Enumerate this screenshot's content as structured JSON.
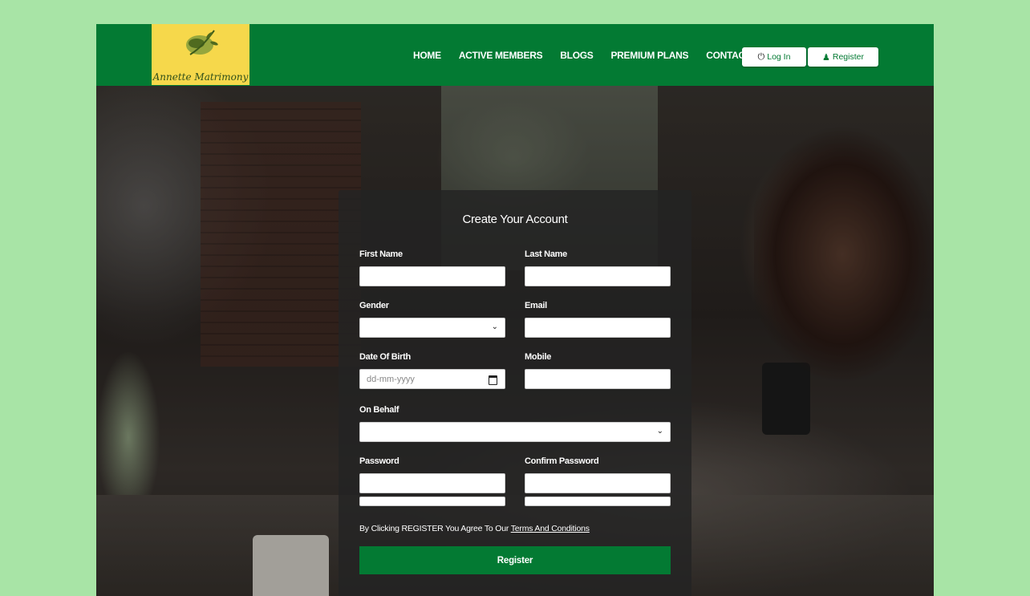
{
  "brand": {
    "logo_text": "Annette Matrimony"
  },
  "nav": {
    "items": [
      "HOME",
      "ACTIVE MEMBERS",
      "BLOGS",
      "PREMIUM PLANS",
      "CONTACT US"
    ],
    "login_label": "Log In",
    "register_label": "Register"
  },
  "form": {
    "title": "Create Your Account",
    "first_name_label": "First Name",
    "last_name_label": "Last Name",
    "gender_label": "Gender",
    "email_label": "Email",
    "dob_label": "Date Of Birth",
    "dob_placeholder": "dd-mm-yyyy",
    "mobile_label": "Mobile",
    "on_behalf_label": "On Behalf",
    "password_label": "Password",
    "confirm_password_label": "Confirm Password",
    "terms_prefix": "By Clicking REGISTER You Agree To Our ",
    "terms_link": "Terms And Conditions",
    "submit_label": "Register"
  },
  "colors": {
    "brand_green": "#037a33",
    "page_bg": "#a8e4a6",
    "logo_bg": "#f6d84b"
  }
}
